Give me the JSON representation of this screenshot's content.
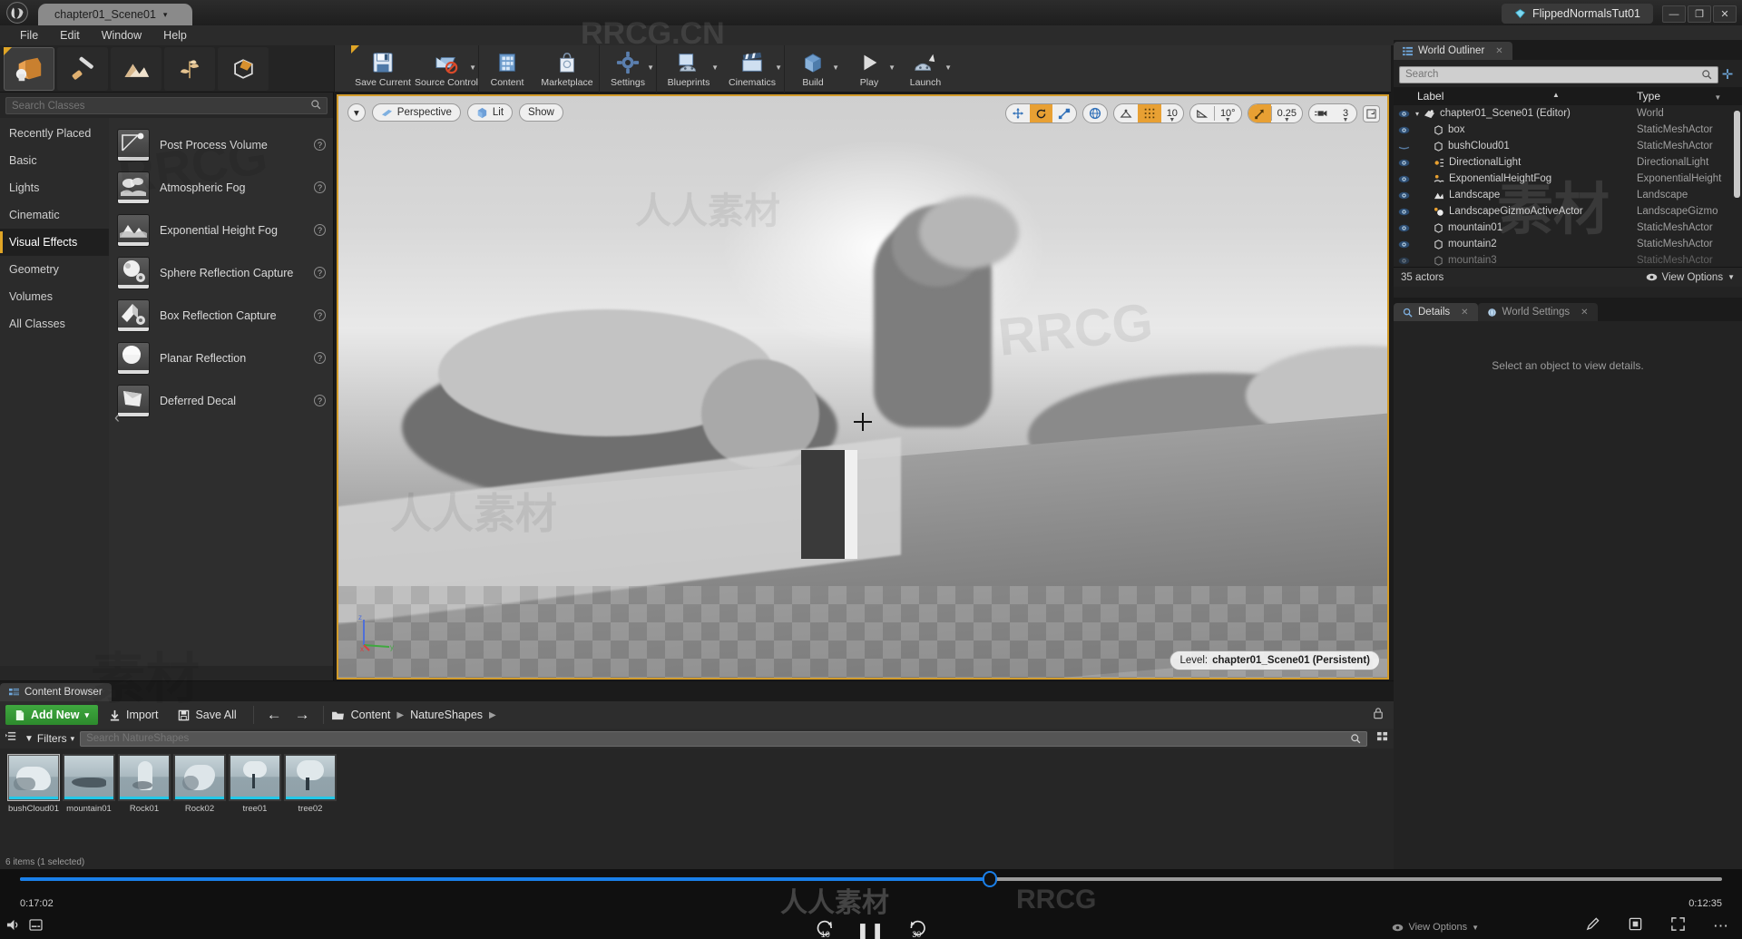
{
  "titlebar": {
    "project_tab": "chapter01_Scene01",
    "right_tab": "FlippedNormalsTut01",
    "minimize": "—",
    "maximize": "❐",
    "close": "✕"
  },
  "menubar": {
    "items": [
      "File",
      "Edit",
      "Window",
      "Help"
    ]
  },
  "modes": {
    "items": [
      {
        "name": "place-mode",
        "active": true
      },
      {
        "name": "paint-mode",
        "active": false
      },
      {
        "name": "landscape-mode",
        "active": false
      },
      {
        "name": "foliage-mode",
        "active": false
      },
      {
        "name": "geometry-editing-mode",
        "active": false
      }
    ]
  },
  "place_panel": {
    "search_placeholder": "Search Classes",
    "search_value": "",
    "categories": [
      "Recently Placed",
      "Basic",
      "Lights",
      "Cinematic",
      "Visual Effects",
      "Geometry",
      "Volumes",
      "All Classes"
    ],
    "active_category": "Visual Effects",
    "actors": [
      {
        "label": "Post Process Volume",
        "help": "?"
      },
      {
        "label": "Atmospheric Fog",
        "help": "?"
      },
      {
        "label": "Exponential Height Fog",
        "help": "?"
      },
      {
        "label": "Sphere Reflection Capture",
        "help": "?"
      },
      {
        "label": "Box Reflection Capture",
        "help": "?"
      },
      {
        "label": "Planar Reflection",
        "help": "?"
      },
      {
        "label": "Deferred Decal",
        "help": "?"
      }
    ]
  },
  "main_toolbar": {
    "groups": [
      {
        "items": [
          {
            "label": "Save Current",
            "icon": "save-icon",
            "caret": false
          },
          {
            "label": "Source Control",
            "icon": "source-control-icon",
            "caret": true
          }
        ]
      },
      {
        "items": [
          {
            "label": "Content",
            "icon": "content-icon",
            "caret": false
          },
          {
            "label": "Marketplace",
            "icon": "marketplace-icon",
            "caret": false
          }
        ]
      },
      {
        "items": [
          {
            "label": "Settings",
            "icon": "settings-icon",
            "caret": true
          }
        ]
      },
      {
        "items": [
          {
            "label": "Blueprints",
            "icon": "blueprints-icon",
            "caret": true
          },
          {
            "label": "Cinematics",
            "icon": "cinematics-icon",
            "caret": true
          }
        ]
      },
      {
        "items": [
          {
            "label": "Build",
            "icon": "build-icon",
            "caret": true
          },
          {
            "label": "Play",
            "icon": "play-icon",
            "caret": true
          },
          {
            "label": "Launch",
            "icon": "launch-icon",
            "caret": true
          }
        ]
      }
    ]
  },
  "viewport": {
    "view_menu_caret": "▾",
    "perspective": "Perspective",
    "lit": "Lit",
    "show": "Show",
    "grid_snap_value": "10",
    "rotation_snap_value": "10°",
    "scale_snap_value": "0.25",
    "camera_speed_value": "3",
    "level_label": "Level:",
    "level_name": "chapter01_Scene01 (Persistent)",
    "axis_x": "x",
    "axis_y": "y",
    "axis_z": "z"
  },
  "outliner": {
    "tab_label": "World Outliner",
    "search_placeholder": "Search",
    "search_value": "",
    "col_label": "Label",
    "col_type": "Type",
    "rows": [
      {
        "label": "chapter01_Scene01 (Editor)",
        "type": "World",
        "depth": 0,
        "icon": "world-icon",
        "visible": true,
        "expander": "▾"
      },
      {
        "label": "box",
        "type": "StaticMeshActor",
        "depth": 1,
        "icon": "mesh-icon",
        "visible": true
      },
      {
        "label": "bushCloud01",
        "type": "StaticMeshActor",
        "depth": 1,
        "icon": "mesh-icon",
        "visible": false
      },
      {
        "label": "DirectionalLight",
        "type": "DirectionalLight",
        "depth": 1,
        "icon": "light-icon",
        "visible": true
      },
      {
        "label": "ExponentialHeightFog",
        "type": "ExponentialHeight",
        "depth": 1,
        "icon": "fog-icon",
        "visible": true
      },
      {
        "label": "Landscape",
        "type": "Landscape",
        "depth": 1,
        "icon": "landscape-icon",
        "visible": true
      },
      {
        "label": "LandscapeGizmoActiveActor",
        "type": "LandscapeGizmo",
        "depth": 1,
        "icon": "gizmo-icon",
        "visible": true
      },
      {
        "label": "mountain01",
        "type": "StaticMeshActor",
        "depth": 1,
        "icon": "mesh-icon",
        "visible": true
      },
      {
        "label": "mountain2",
        "type": "StaticMeshActor",
        "depth": 1,
        "icon": "mesh-icon",
        "visible": true
      },
      {
        "label": "mountain3",
        "type": "StaticMeshActor",
        "depth": 1,
        "icon": "mesh-icon",
        "visible": true
      }
    ],
    "footer_count": "35 actors",
    "view_options": "View Options"
  },
  "details": {
    "tab_details": "Details",
    "tab_world_settings": "World Settings",
    "empty_message": "Select an object to view details."
  },
  "content_browser": {
    "tab_label": "Content Browser",
    "add_new": "Add New",
    "import": "Import",
    "save_all": "Save All",
    "back_arrow": "←",
    "forward_arrow": "→",
    "breadcrumb": [
      "Content",
      "NatureShapes"
    ],
    "filters": "Filters",
    "search_placeholder": "Search NatureShapes",
    "search_value": "",
    "assets": [
      {
        "name": "bushCloud01",
        "selected": true
      },
      {
        "name": "mountain01",
        "selected": false
      },
      {
        "name": "Rock01",
        "selected": false
      },
      {
        "name": "Rock02",
        "selected": false
      },
      {
        "name": "tree01",
        "selected": false
      },
      {
        "name": "tree02",
        "selected": false
      }
    ],
    "footer_status": "6 items (1 selected)"
  },
  "player": {
    "elapsed": "0:17:02",
    "remaining": "0:12:35",
    "progress_percent": 57,
    "rewind_label": "10",
    "forward_label": "30",
    "pause": "❚❚",
    "view_options": "View Options"
  },
  "colors": {
    "accent_orange": "#e0a526",
    "viewport_border": "#d39c2a",
    "add_new_green": "#3fa83f",
    "progress_blue": "#1a7fe8",
    "asset_cyan": "#23c8e8"
  },
  "watermarks": [
    "RRCG.CN",
    "RRCG",
    "人人素材",
    "素材"
  ]
}
